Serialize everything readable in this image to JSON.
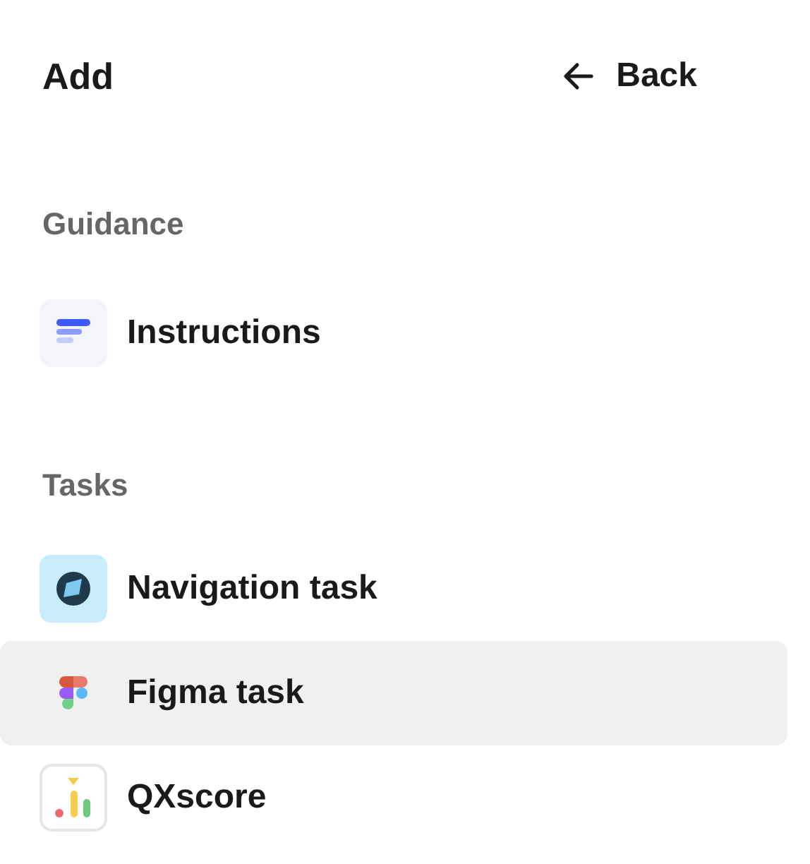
{
  "header": {
    "title": "Add",
    "back": {
      "label": "Back"
    }
  },
  "sections": [
    {
      "title": "Guidance",
      "items": [
        {
          "label": "Instructions",
          "kind": "instructions",
          "selected": false
        }
      ]
    },
    {
      "title": "Tasks",
      "items": [
        {
          "label": "Navigation task",
          "kind": "navigation",
          "selected": false
        },
        {
          "label": "Figma task",
          "kind": "figma",
          "selected": true
        },
        {
          "label": "QXscore",
          "kind": "qxscore",
          "selected": false
        }
      ]
    }
  ]
}
